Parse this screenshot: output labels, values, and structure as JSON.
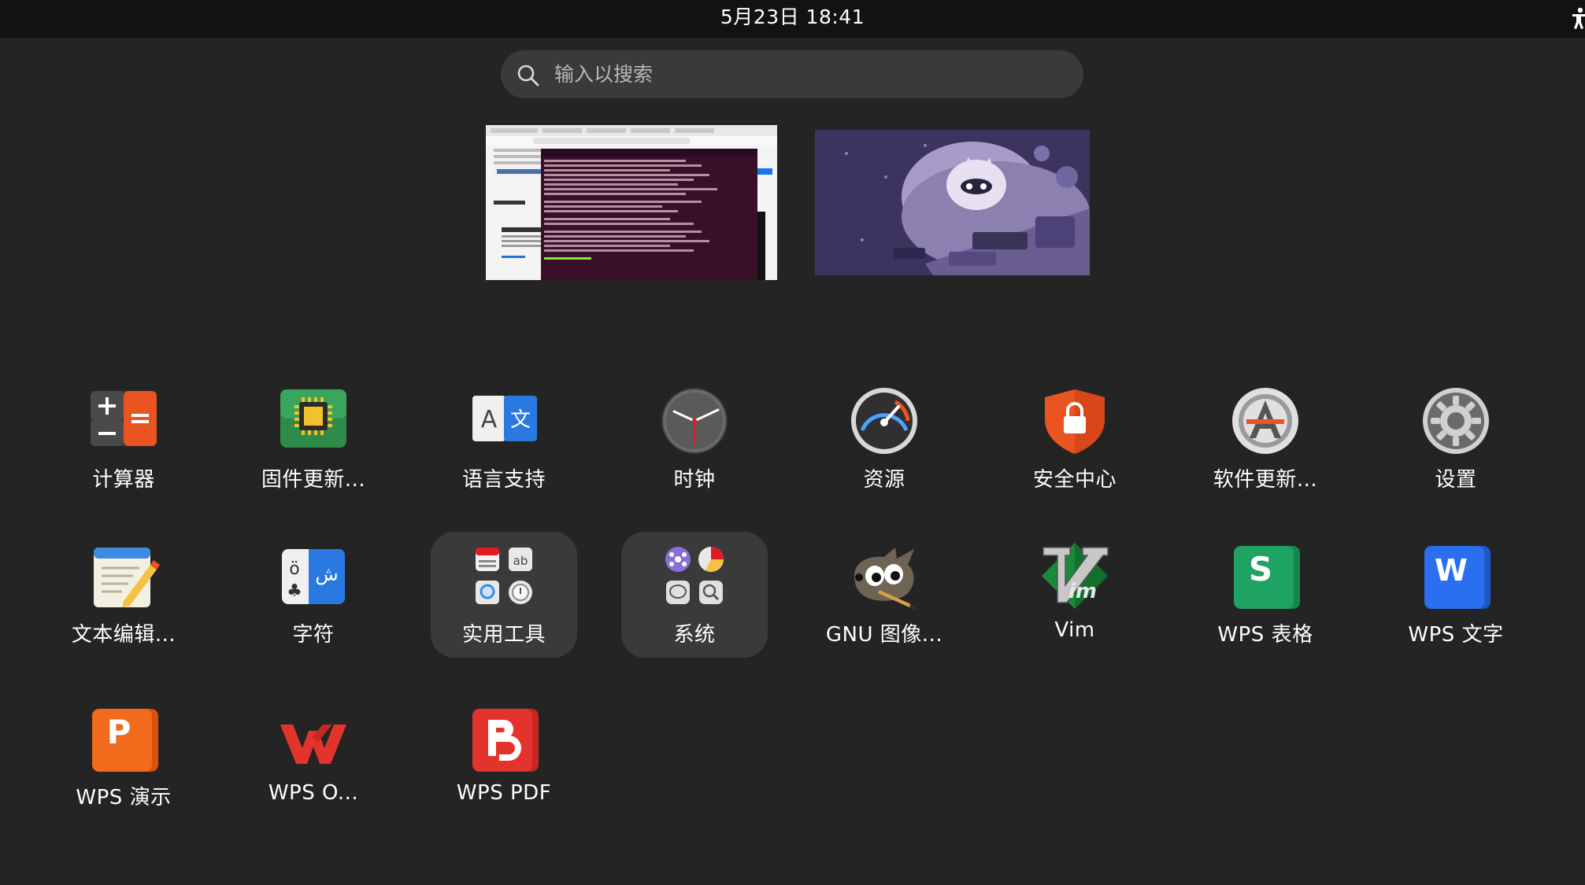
{
  "topbar": {
    "datetime": "5月23日  18:41"
  },
  "search": {
    "placeholder": "输入以搜索"
  },
  "workspaces": [
    "workspace-1",
    "workspace-2"
  ],
  "apps": [
    {
      "id": "calculator",
      "label": "计算器"
    },
    {
      "id": "firmware",
      "label": "固件更新..."
    },
    {
      "id": "language",
      "label": "语言支持"
    },
    {
      "id": "clock",
      "label": "时钟"
    },
    {
      "id": "resources",
      "label": "资源"
    },
    {
      "id": "security",
      "label": "安全中心"
    },
    {
      "id": "software-updater",
      "label": "软件更新..."
    },
    {
      "id": "settings",
      "label": "设置"
    },
    {
      "id": "text-editor",
      "label": "文本编辑..."
    },
    {
      "id": "characters",
      "label": "字符"
    },
    {
      "id": "utilities",
      "label": "实用工具"
    },
    {
      "id": "system",
      "label": "系统"
    },
    {
      "id": "gimp",
      "label": "GNU 图像..."
    },
    {
      "id": "vim",
      "label": "Vim"
    },
    {
      "id": "wps-sheets",
      "label": "WPS 表格"
    },
    {
      "id": "wps-writer",
      "label": "WPS 文字"
    },
    {
      "id": "wps-presentation",
      "label": "WPS 演示"
    },
    {
      "id": "wps-office",
      "label": "WPS O..."
    },
    {
      "id": "wps-pdf",
      "label": "WPS PDF"
    }
  ],
  "colors": {
    "background": "#242424",
    "topbar": "#121212",
    "folder": "#3a3a3a",
    "security": "#e95420",
    "wps_red": "#e2342d",
    "wps_green": "#1ea362",
    "wps_blue": "#2a6ff0",
    "wps_orange": "#f26a1b"
  }
}
